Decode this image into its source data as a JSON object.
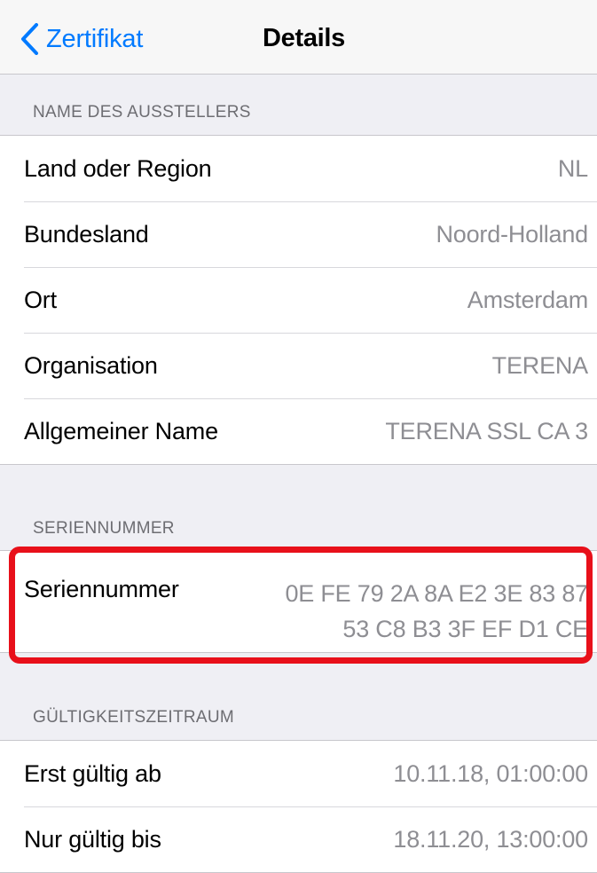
{
  "navbar": {
    "back_label": "Zertifikat",
    "title": "Details"
  },
  "issuer_section": {
    "header": "NAME DES AUSSTELLERS",
    "rows": [
      {
        "label": "Land oder Region",
        "value": "NL"
      },
      {
        "label": "Bundesland",
        "value": "Noord-Holland"
      },
      {
        "label": "Ort",
        "value": "Amsterdam"
      },
      {
        "label": "Organisation",
        "value": "TERENA"
      },
      {
        "label": "Allgemeiner Name",
        "value": "TERENA SSL CA 3"
      }
    ]
  },
  "serial_section": {
    "header": "SERIENNUMMER",
    "label": "Seriennummer",
    "value_line1": "0E FE 79 2A 8A E2 3E 83 87",
    "value_line2": "53 C8 B3 3F EF D1 CE"
  },
  "validity_section": {
    "header": "GÜLTIGKEITSZEITRAUM",
    "rows": [
      {
        "label": "Erst gültig ab",
        "value": "10.11.18, 01:00:00"
      },
      {
        "label": "Nur gültig bis",
        "value": "18.11.20, 13:00:00"
      }
    ]
  },
  "colors": {
    "accent": "#007aff",
    "highlight": "#e8101a",
    "background": "#efeff4",
    "secondary_text": "#8e8e93"
  },
  "icons": {
    "back": "chevron-left-icon"
  }
}
